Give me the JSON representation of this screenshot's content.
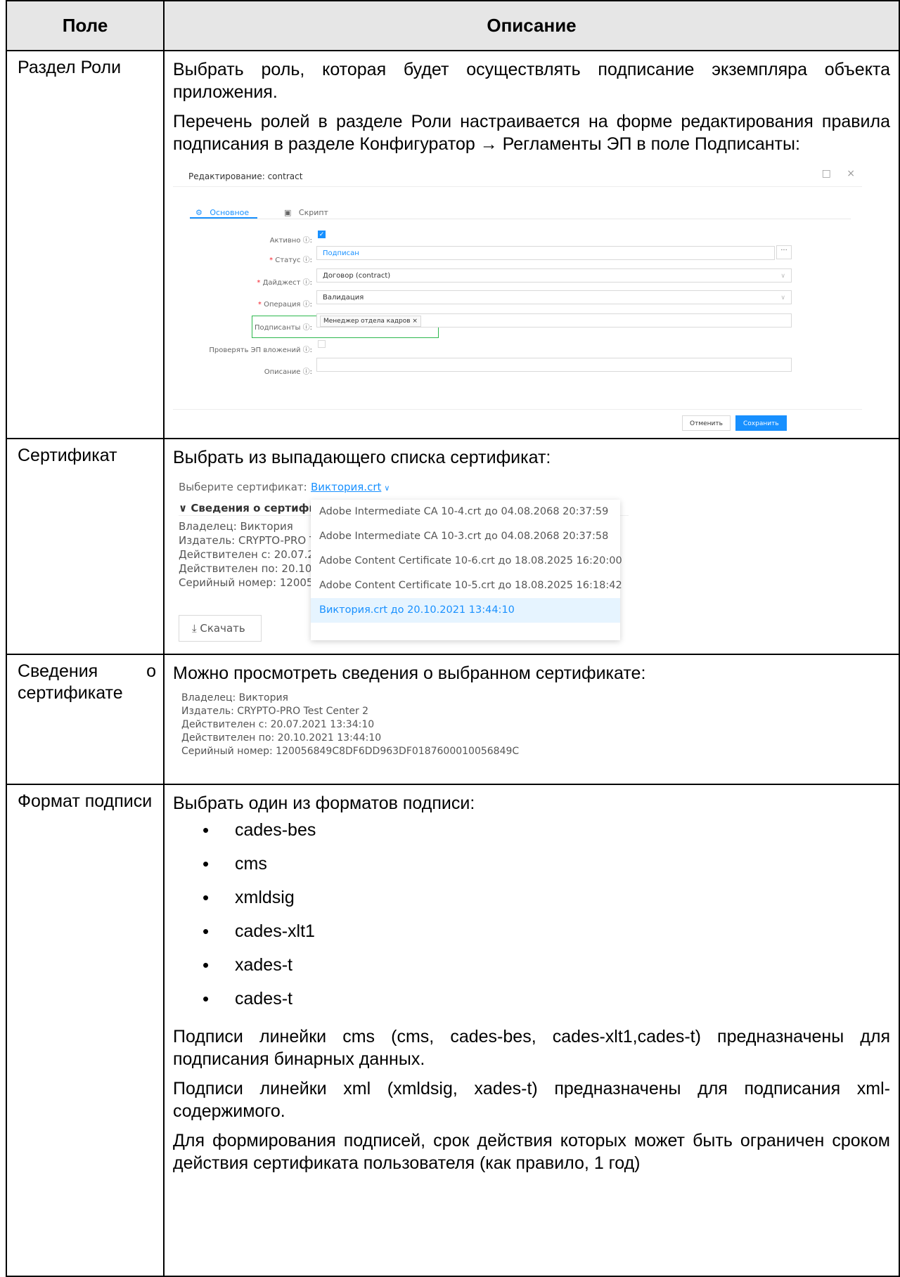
{
  "table": {
    "header": {
      "field": "Поле",
      "description": "Описание"
    }
  },
  "rows": {
    "roles": {
      "field": "Раздел Роли",
      "p1": "Выбрать роль, которая будет осуществлять подписание экземпляра объекта приложения.",
      "p2": "Перечень ролей в разделе Роли настраивается на форме редактирования правила подписания в разделе Конфигуратор → Регламенты ЭП в поле Подписанты:"
    },
    "certificate": {
      "field": "Сертификат",
      "p1": "Выбрать из выпадающего списка сертификат:"
    },
    "cert_info": {
      "field_word1": "Сведения",
      "field_word2": "о",
      "field_word3": "сертификате",
      "p1": "Можно просмотреть сведения о выбранном сертификате:"
    },
    "format": {
      "field": "Формат подписи",
      "p1": "Выбрать один из форматов подписи:",
      "formats": [
        "cades-bes",
        "cms",
        "xmldsig",
        "cades-xlt1",
        "xades-t",
        "cades-t"
      ],
      "p2": "Подписи линейки cms (cms, cades-bes, cades-xlt1,cades-t) предназначены для подписания бинарных данных.",
      "p3": "Подписи линейки xml (xmldsig, xades-t) предназначены для подписания xml-содержимого.",
      "p4": "Для формирования подписей, срок действия которых может быть ограничен сроком действия сертификата пользователя (как правило, 1 год)"
    }
  },
  "edit_form": {
    "title": "Редактирование: contract",
    "maximize_icon": "□",
    "close_icon": "×",
    "tab_main": "Основное",
    "tab_script": "Скрипт",
    "active_label": "Активно ⓘ:",
    "status_label": "Статус ⓘ:",
    "status_value": "Подписан",
    "digest_label": "Дайджест ⓘ:",
    "digest_value": "Договор (contract)",
    "operation_label": "Операция ⓘ:",
    "operation_value": "Валидация",
    "signers_label": "Подписанты ⓘ:",
    "signers_tag": "Менеджер отдела кадров ×",
    "check_label": "Проверять ЭП вложений ⓘ:",
    "description_label": "Описание ⓘ:",
    "ellipsis": "···",
    "cancel": "Отменить",
    "save": "Сохранить",
    "accent_color": "#1890ff",
    "highlight_color": "#2db84d"
  },
  "cert_picker": {
    "choose_label": "Выберите сертификат:",
    "selected": "Виктория.crt",
    "section_title": "∨ Сведения о сертифик",
    "info_lines": [
      "Владелец: Виктория",
      "Издатель: CRYPTO-PRO Te",
      "Действителен с: 20.07.202",
      "Действителен по: 20.10.20",
      "Серийный номер: 120056"
    ],
    "download": "⤓ Скачать",
    "options": [
      "Adobe Intermediate CA 10-4.crt до 04.08.2068 20:37:59",
      "Adobe Intermediate CA 10-3.crt до 04.08.2068 20:37:58",
      "Adobe Content Certificate 10-6.crt до 18.08.2025 16:20:00",
      "Adobe Content Certificate 10-5.crt до 18.08.2025 16:18:42",
      "Виктория.crt до 20.10.2021 13:44:10"
    ]
  },
  "cert_details": {
    "lines": [
      "Владелец: Виктория",
      "Издатель: CRYPTO-PRO Test Center 2",
      "Действителен с: 20.07.2021 13:34:10",
      "Действителен по: 20.10.2021 13:44:10",
      "Серийный номер: 120056849C8DF6DD963DF0187600010056849C"
    ]
  }
}
